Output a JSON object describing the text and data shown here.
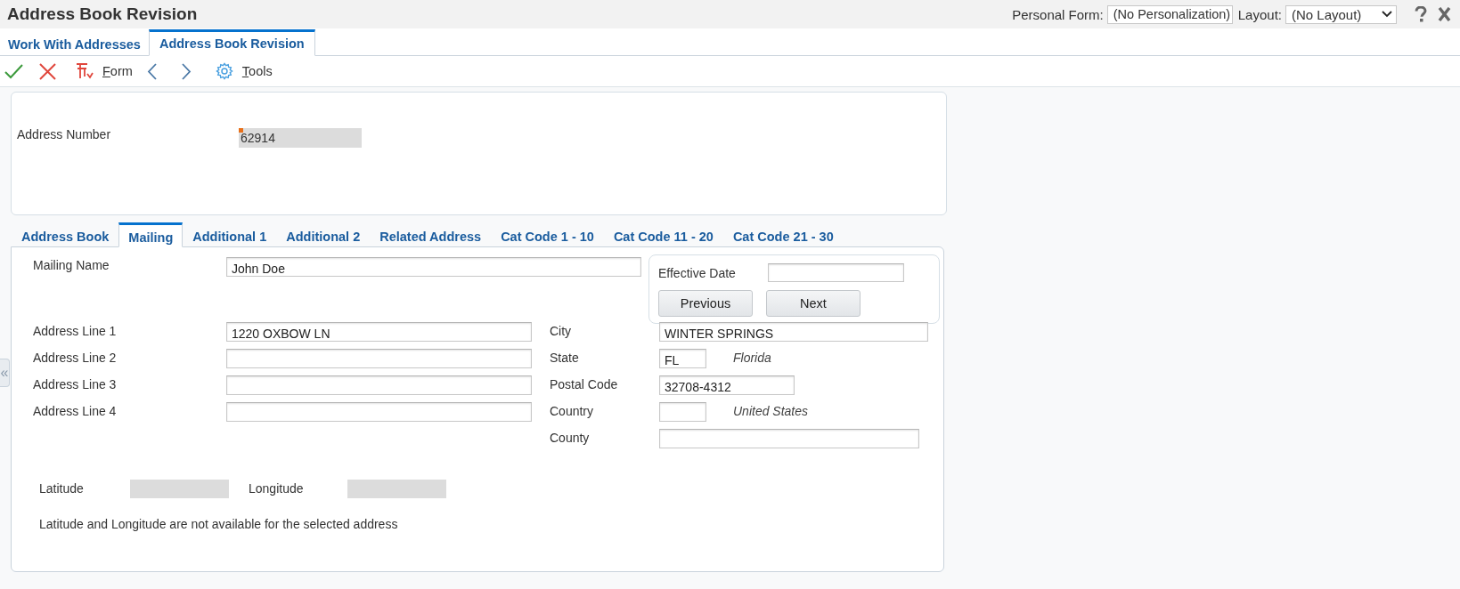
{
  "header": {
    "title": "Address Book Revision",
    "personal_form": {
      "label": "Personal Form:",
      "value": "(No Personalization)"
    },
    "layout": {
      "label": "Layout:",
      "value": "(No Layout)"
    }
  },
  "page_tabs": [
    {
      "label": "Work With Addresses",
      "selected": false
    },
    {
      "label": "Address Book Revision",
      "selected": true
    }
  ],
  "toolbar": [
    {
      "kind": "ok"
    },
    {
      "kind": "cancel"
    },
    {
      "kind": "form",
      "label": "Form"
    },
    {
      "kind": "previous"
    },
    {
      "kind": "next"
    },
    {
      "kind": "tools",
      "label": "Tools"
    }
  ],
  "collapse_handle": "«",
  "address_number": {
    "label": "Address Number",
    "value": "62914",
    "required": true
  },
  "form_tabs": [
    {
      "label": "Address Book",
      "selected": false
    },
    {
      "label": "Mailing",
      "selected": true
    },
    {
      "label": "Additional 1",
      "selected": false
    },
    {
      "label": "Additional 2",
      "selected": false
    },
    {
      "label": "Related Address",
      "selected": false
    },
    {
      "label": "Cat Code 1 - 10",
      "selected": false
    },
    {
      "label": "Cat Code 11 - 20",
      "selected": false
    },
    {
      "label": "Cat Code 21 - 30",
      "selected": false
    }
  ],
  "mailing_name": {
    "label": "Mailing Name",
    "value": "John Doe"
  },
  "effective_date": {
    "label": "Effective Date",
    "buttons": [
      "Previous",
      "Next"
    ]
  },
  "address_lines": [
    {
      "label": "Address Line 1",
      "value": "1220 OXBOW LN"
    },
    {
      "label": "Address Line 2"
    },
    {
      "label": "Address Line 3"
    },
    {
      "label": "Address Line 4"
    }
  ],
  "location_fields": [
    {
      "label": "City",
      "kind": "wide",
      "value": "WINTER SPRINGS"
    },
    {
      "label": "State",
      "kind": "code",
      "value": "FL",
      "description": "Florida"
    },
    {
      "label": "Postal Code",
      "kind": "medium",
      "value": "32708-4312"
    },
    {
      "label": "Country",
      "kind": "code",
      "description": "United States"
    },
    {
      "label": "County",
      "kind": "wide"
    }
  ],
  "geo": {
    "latitude_label": "Latitude",
    "longitude_label": "Longitude",
    "message": "Latitude and Longitude are not available for the selected address"
  }
}
